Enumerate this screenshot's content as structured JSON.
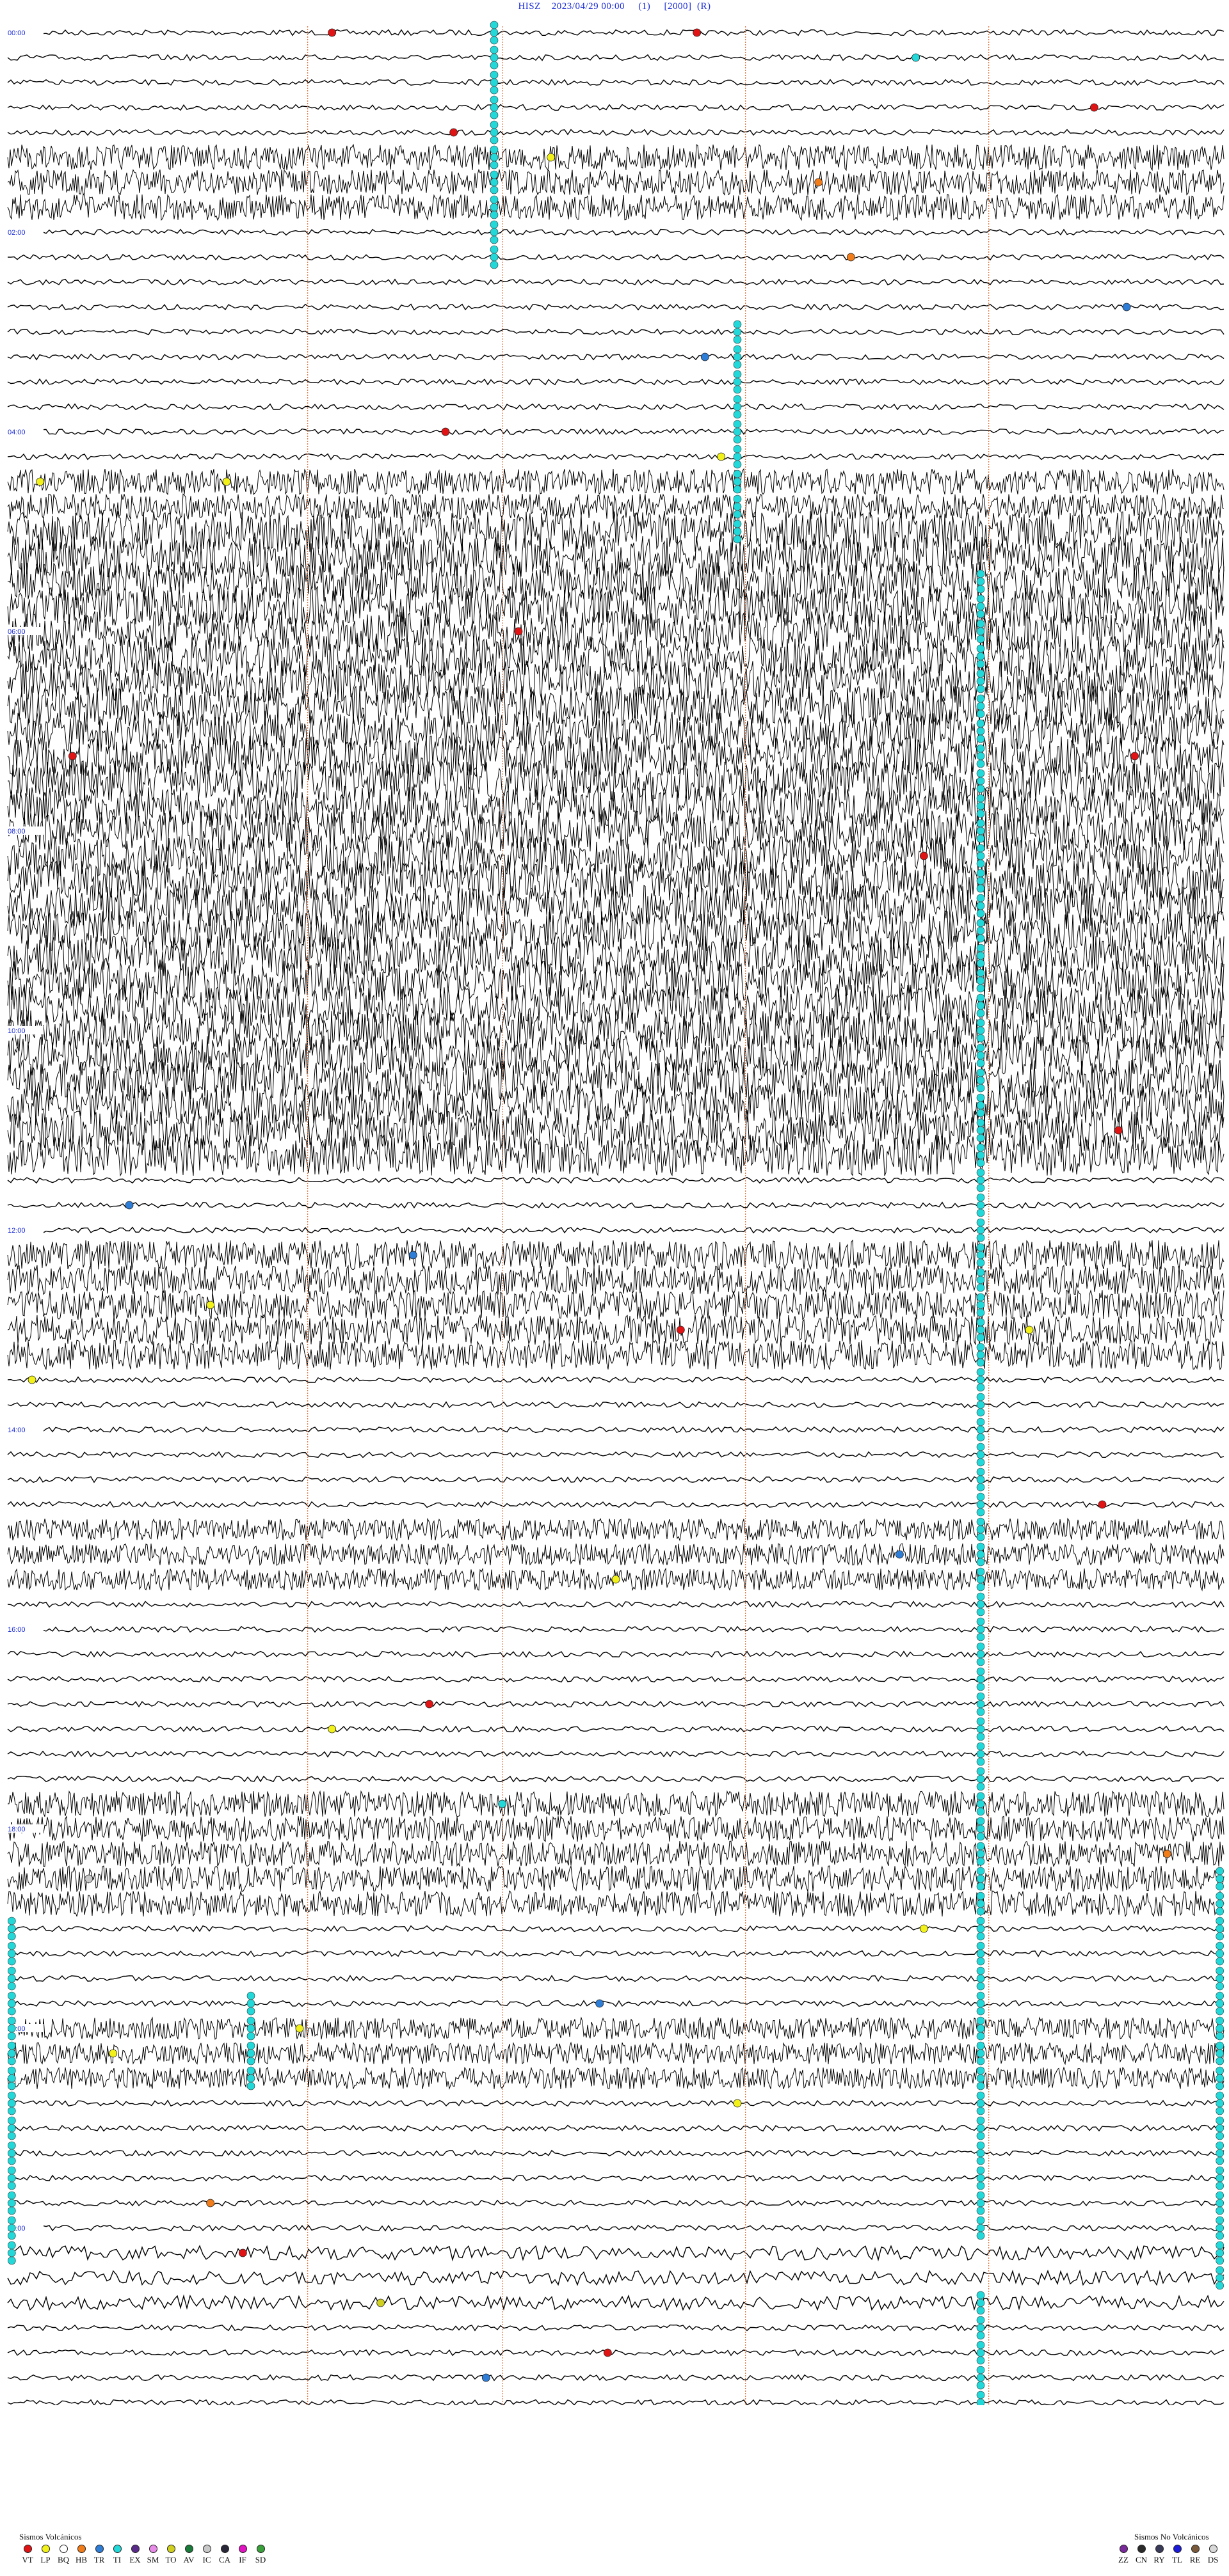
{
  "header": {
    "station": "HISZ",
    "datetime": "2023/04/29 00:00",
    "channel": "(1)",
    "gain": "[2000]",
    "mode": "(R)"
  },
  "chart_data": {
    "type": "helicorder",
    "title": "HISZ    2023/04/29 00:00     (1)     [2000]  (R)",
    "xlabel": "",
    "ylabel": "",
    "trace_count": 96,
    "minutes_per_trace": 15,
    "time_labels": [
      "00:00",
      "02:00",
      "04:00",
      "06:00",
      "08:00",
      "10:00",
      "12:00",
      "14:00",
      "16:00",
      "18:00",
      "20:00",
      "22:00",
      "00:00"
    ],
    "label_every_traces": 8,
    "minute_markers": [
      3.7,
      6.1,
      9.1,
      12.1
    ],
    "noise_bands": [
      {
        "from_trace": 5,
        "to_trace": 7,
        "level": 0.6
      },
      {
        "from_trace": 18,
        "to_trace": 19,
        "level": 0.6
      },
      {
        "from_trace": 20,
        "to_trace": 45,
        "level": 1.0
      },
      {
        "from_trace": 49,
        "to_trace": 53,
        "level": 0.7
      },
      {
        "from_trace": 60,
        "to_trace": 62,
        "level": 0.5
      },
      {
        "from_trace": 71,
        "to_trace": 75,
        "level": 0.6
      },
      {
        "from_trace": 80,
        "to_trace": 82,
        "level": 0.5
      },
      {
        "from_trace": 89,
        "to_trace": 91,
        "level": 0.3
      }
    ],
    "events": [
      {
        "trace": 0,
        "minute": 4.0,
        "type": "VT"
      },
      {
        "trace": 0,
        "minute": 8.5,
        "type": "VT"
      },
      {
        "trace": 1,
        "minute": 11.2,
        "type": "TI"
      },
      {
        "trace": 3,
        "minute": 13.4,
        "type": "VT"
      },
      {
        "trace": 4,
        "minute": 5.5,
        "type": "VT"
      },
      {
        "trace": 5,
        "minute": 6.7,
        "type": "LP"
      },
      {
        "trace": 6,
        "minute": 10.0,
        "type": "HB"
      },
      {
        "trace": 9,
        "minute": 10.4,
        "type": "HB"
      },
      {
        "trace": 11,
        "minute": 13.8,
        "type": "TR"
      },
      {
        "trace": 13,
        "minute": 8.6,
        "type": "TR"
      },
      {
        "trace": 16,
        "minute": 5.4,
        "type": "VT"
      },
      {
        "trace": 17,
        "minute": 8.8,
        "type": "LP"
      },
      {
        "trace": 18,
        "minute": 0.4,
        "type": "LP"
      },
      {
        "trace": 18,
        "minute": 2.7,
        "type": "LP"
      },
      {
        "trace": 24,
        "minute": 6.3,
        "type": "VT"
      },
      {
        "trace": 29,
        "minute": 0.8,
        "type": "VT"
      },
      {
        "trace": 29,
        "minute": 13.9,
        "type": "VT"
      },
      {
        "trace": 33,
        "minute": 11.3,
        "type": "VT"
      },
      {
        "trace": 44,
        "minute": 13.7,
        "type": "VT"
      },
      {
        "trace": 47,
        "minute": 1.5,
        "type": "TR"
      },
      {
        "trace": 49,
        "minute": 5.0,
        "type": "TR"
      },
      {
        "trace": 51,
        "minute": 2.5,
        "type": "LP"
      },
      {
        "trace": 52,
        "minute": 8.3,
        "type": "VT"
      },
      {
        "trace": 52,
        "minute": 12.6,
        "type": "LP"
      },
      {
        "trace": 54,
        "minute": 0.3,
        "type": "LP"
      },
      {
        "trace": 59,
        "minute": 13.5,
        "type": "VT"
      },
      {
        "trace": 61,
        "minute": 11.0,
        "type": "TR"
      },
      {
        "trace": 62,
        "minute": 7.5,
        "type": "LP"
      },
      {
        "trace": 67,
        "minute": 5.2,
        "type": "VT"
      },
      {
        "trace": 68,
        "minute": 4.0,
        "type": "LP"
      },
      {
        "trace": 71,
        "minute": 6.1,
        "type": "TI"
      },
      {
        "trace": 73,
        "minute": 14.3,
        "type": "HB"
      },
      {
        "trace": 74,
        "minute": 1.0,
        "type": "IC"
      },
      {
        "trace": 76,
        "minute": 11.3,
        "type": "LP"
      },
      {
        "trace": 79,
        "minute": 7.3,
        "type": "TR"
      },
      {
        "trace": 80,
        "minute": 3.6,
        "type": "LP"
      },
      {
        "trace": 81,
        "minute": 1.3,
        "type": "LP"
      },
      {
        "trace": 83,
        "minute": 9.0,
        "type": "LP"
      },
      {
        "trace": 87,
        "minute": 2.5,
        "type": "HB"
      },
      {
        "trace": 89,
        "minute": 2.9,
        "type": "VT"
      },
      {
        "trace": 91,
        "minute": 4.6,
        "type": "TO"
      },
      {
        "trace": 93,
        "minute": 7.4,
        "type": "VT"
      },
      {
        "trace": 94,
        "minute": 5.9,
        "type": "TR"
      }
    ],
    "tremor_columns": [
      {
        "minute": 6.0,
        "from_trace": 0,
        "to_trace": 9,
        "type": "TI"
      },
      {
        "minute": 9.0,
        "from_trace": 12,
        "to_trace": 20,
        "type": "TI"
      },
      {
        "minute": 12.0,
        "from_trace": 22,
        "to_trace": 88,
        "type": "TI"
      },
      {
        "minute": 12.0,
        "from_trace": 91,
        "to_trace": 95,
        "type": "TI"
      },
      {
        "minute": 3.0,
        "from_trace": 79,
        "to_trace": 82,
        "type": "TI"
      },
      {
        "minute": 0.05,
        "from_trace": 76,
        "to_trace": 89,
        "type": "TI"
      },
      {
        "minute": 14.95,
        "from_trace": 74,
        "to_trace": 90,
        "type": "TI"
      }
    ]
  },
  "legend_volcanic": {
    "title": "Sismos Volcánicos",
    "items": [
      {
        "code": "VT",
        "color": "#e01414"
      },
      {
        "code": "LP",
        "color": "#f2f21a"
      },
      {
        "code": "BQ",
        "color": "#ffffff"
      },
      {
        "code": "HB",
        "color": "#f07c1a"
      },
      {
        "code": "TR",
        "color": "#2e7dd6"
      },
      {
        "code": "TI",
        "color": "#22d8d8"
      },
      {
        "code": "EX",
        "color": "#5a2a8a"
      },
      {
        "code": "SM",
        "color": "#e88ae8"
      },
      {
        "code": "TO",
        "color": "#d0d020"
      },
      {
        "code": "AV",
        "color": "#1a7a3a"
      },
      {
        "code": "IC",
        "color": "#c8c8c8"
      },
      {
        "code": "CA",
        "color": "#282838"
      },
      {
        "code": "IF",
        "color": "#e014c0"
      },
      {
        "code": "SD",
        "color": "#3aa03a"
      }
    ]
  },
  "legend_nonvolcanic": {
    "title": "Sismos No Volcánicos",
    "items": [
      {
        "code": "ZZ",
        "color": "#7a2a9a"
      },
      {
        "code": "CN",
        "color": "#2a2a2a"
      },
      {
        "code": "RY",
        "color": "#3a3a5a"
      },
      {
        "code": "TL",
        "color": "#1a1ad8"
      },
      {
        "code": "RE",
        "color": "#7a5a3a"
      },
      {
        "code": "DS",
        "color": "#d8d8d8"
      }
    ]
  }
}
